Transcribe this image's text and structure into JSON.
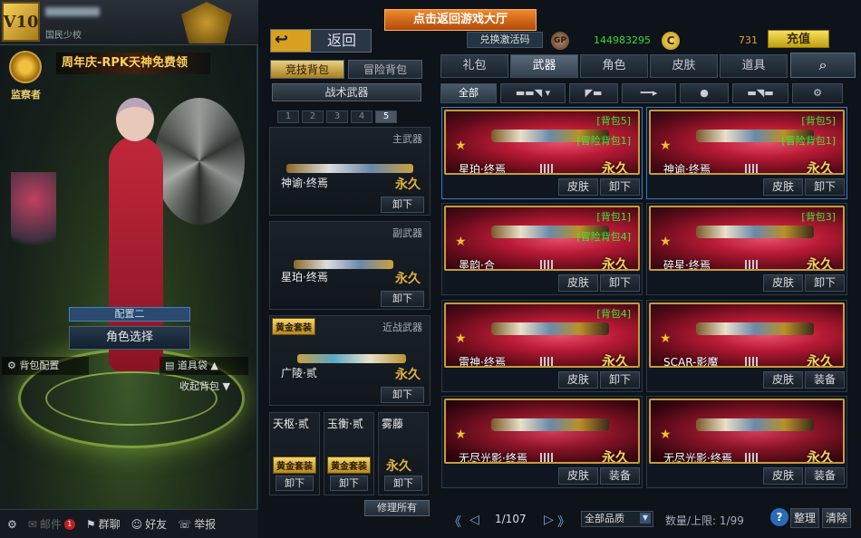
{
  "profile": {
    "vip_label": "V10",
    "rank_text": "国民少校"
  },
  "left": {
    "watcher_label": "监察者",
    "anniversary_banner": "周年庆-RPK天神免费领",
    "config_label": "配置二",
    "role_select": "角色选择",
    "bag_config": "背包配置",
    "tool_bag": "道具袋",
    "collapse_bag": "收起背包"
  },
  "bottom_bar": {
    "settings": "⚙",
    "mail": "邮件",
    "mail_badge": "1",
    "group_chat": "群聊",
    "friends": "好友",
    "report": "举报"
  },
  "top": {
    "back_label": "返回",
    "lobby_button": "点击返回游戏大厅",
    "redeem_code": "兑换激活码",
    "gp_icon": "GP",
    "gp_value": "144983295",
    "cf_icon": "C",
    "cf_value": "731",
    "charge": "充值"
  },
  "bag_tabs": [
    "竞技背包",
    "冒险背包"
  ],
  "tactical_weapons": "战术武器",
  "bag_pages": [
    "1",
    "2",
    "3",
    "4",
    "5"
  ],
  "slots": {
    "primary": {
      "category": "主武器",
      "name": "神谕·终焉",
      "perm": "永久",
      "unload": "卸下"
    },
    "secondary": {
      "category": "副武器",
      "name": "星珀·终焉",
      "perm": "永久",
      "unload": "卸下"
    },
    "melee": {
      "category": "近战武器",
      "badge": "黄金套装",
      "name": "广陵·贰",
      "perm": "永久",
      "unload": "卸下"
    },
    "minis": [
      {
        "name": "天枢·贰",
        "badge": "黄金套装",
        "unload": "卸下"
      },
      {
        "name": "玉衡·贰",
        "badge": "黄金套装",
        "unload": "卸下"
      },
      {
        "name": "雾藤",
        "perm": "永久",
        "unload": "卸下"
      }
    ],
    "repair_all": "修理所有"
  },
  "category_tabs": [
    "礼包",
    "武器",
    "角色",
    "皮肤",
    "道具"
  ],
  "filter_tabs": {
    "all": "全部",
    "icons": [
      "rifle-icon",
      "pistol-icon",
      "knife-icon",
      "grenade-icon",
      "smg-icon",
      "gear-icon"
    ]
  },
  "cards": [
    {
      "name": "星珀·终焉",
      "bag": "[背包5]",
      "bag2": "[冒险背包1]",
      "perm": "永久",
      "b1": "皮肤",
      "b2": "卸下"
    },
    {
      "name": "神谕·终焉",
      "bag": "[背包5]",
      "bag2": "[冒险背包1]",
      "perm": "永久",
      "b1": "皮肤",
      "b2": "卸下"
    },
    {
      "name": "墨韵·合",
      "bag": "[背包1]",
      "bag2": "[冒险背包4]",
      "perm": "永久",
      "b1": "皮肤",
      "b2": "卸下"
    },
    {
      "name": "碎星·终焉",
      "bag": "[背包3]",
      "bag2": "",
      "perm": "永久",
      "b1": "皮肤",
      "b2": "卸下"
    },
    {
      "name": "雷神·终焉",
      "bag": "[背包4]",
      "bag2": "",
      "perm": "永久",
      "b1": "皮肤",
      "b2": "卸下"
    },
    {
      "name": "SCAR-影魔",
      "bag": "",
      "bag2": "",
      "perm": "永久",
      "b1": "皮肤",
      "b2": "装备"
    },
    {
      "name": "无尽光影·终焉",
      "bag": "",
      "bag2": "",
      "perm": "永久",
      "b1": "皮肤",
      "b2": "装备"
    },
    {
      "name": "无尽光影·终焉",
      "bag": "",
      "bag2": "",
      "perm": "永久",
      "b1": "皮肤",
      "b2": "装备"
    }
  ],
  "footer": {
    "page": "1/107",
    "quality": "全部品质",
    "count": "数量/上限: 1/99",
    "help": "?",
    "organize": "整理",
    "clear": "清除"
  }
}
